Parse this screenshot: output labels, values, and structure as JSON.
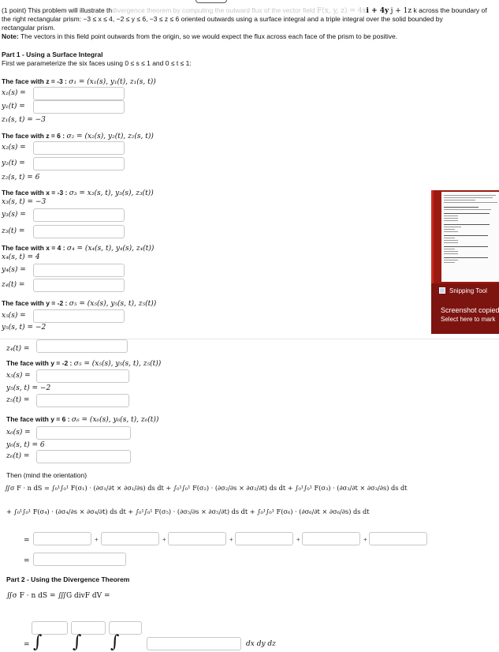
{
  "intro": {
    "line1_a": "(1 point) This problem will illustrate th",
    "line1_b": "divergence theorem by computing the outward flux of the vector field",
    "line1_c": "F(x, y, z) = 4x",
    "line1_d": "i + 4y",
    "line1_e": "j + 1z",
    "line1_f": "k across the boundary of",
    "line2": "the right rectangular prism: −3 ≤ x ≤ 4, −2 ≤ y ≤ 6, −3 ≤ z ≤ 6 oriented outwards using a surface integral and a triple integral over the solid bounded by",
    "line3": "rectangular prism.",
    "note_label": "Note:",
    "note_text": " The vectors in this field point outwards from the origin, so we would expect the flux across each face of the prism to be positive."
  },
  "part1": {
    "title": "Part 1 - Using a Surface Integral",
    "subtitle": "First we parameterize the six faces using 0 ≤ s ≤ 1 and 0 ≤ t ≤ 1:"
  },
  "faces": [
    {
      "title": "The face with z = -3 :",
      "math": "σ₁ = (x₁(s), y₁(t), z₁(s, t))",
      "l1": "x₁(s) =",
      "l2": "y₁(t) =",
      "l3": "z₁(s, t) = −3"
    },
    {
      "title": "The face with z = 6 :",
      "math": "σ₂ = (x₂(s), y₂(t), z₂(s, t))",
      "l1": "x₂(s) =",
      "l2": "y₂(t) =",
      "l3": "z₂(s, t) = 6"
    },
    {
      "title": "The face with x = -3 :",
      "math": "σ₃ = x₃(s, t), y₃(s), z₃(t))",
      "l1": "x₃(s, t) = −3",
      "l2": "y₃(s) =",
      "l3": "z₃(t) ="
    },
    {
      "title": "The face with x = 4 :",
      "math": "σ₄ = (x₄(s, t), y₄(s), z₄(t))",
      "l1": "x₄(s, t) = 4",
      "l2": "y₄(s) =",
      "l3": "z₄(t) ="
    },
    {
      "title": "The face with y = -2 :",
      "math": "σ₅ = (x₅(s), y₅(s, t), z₅(t))",
      "l1": "x₅(s) =",
      "l2": "y₅(s, t) = −2"
    }
  ],
  "second": {
    "z4": "z₄(t) =",
    "face5_title": "The face with y = -2 :",
    "face5_math": "σ₅ = (x₅(s), y₅(s, t), z₅(t))",
    "face5_l1": "x₅(s) =",
    "face5_l2": "y₅(s, t) = −2",
    "face5_l3": "z₅(t) =",
    "face6_title": "The face with y = 6 :",
    "face6_math": "σ₆ = (x₆(s), y₆(s, t), z₆(t))",
    "face6_l1": "x₆(s) =",
    "face6_l2": "y₆(s, t) = 6",
    "face6_l3": "z₆(t) =",
    "then": "Then (mind the orientation)",
    "eq1": "∬σ F · n dS = ∫₀¹∫₀¹ F(σ₁) · (∂σ₁/∂t × ∂σ₁/∂s) ds dt + ∫₀¹∫₀¹ F(σ₂) · (∂σ₂/∂s × ∂σ₂/∂t) ds dt + ∫₀¹∫₀¹ F(σ₃) · (∂σ₃/∂t × ∂σ₃/∂s) ds dt",
    "eq2": "+ ∫₀¹∫₀¹ F(σ₄) · (∂σ₄/∂s × ∂σ₄/∂t) ds dt + ∫₀¹∫₀¹ F(σ₅) · (∂σ₅/∂s × ∂σ₅/∂t) ds dt + ∫₀¹∫₀¹ F(σ₆) · (∂σ₆/∂t × ∂σ₆/∂s) ds dt",
    "eq_sign": "=",
    "plus": "+",
    "part2_title": "Part 2 - Using the Divergence Theorem",
    "part2_eq": "∬σ F · n dS = ∭G divF dV =",
    "last_eq": "=",
    "last_diff": "dx dy dz"
  },
  "snipping": {
    "app": "Snipping Tool",
    "title": "Screenshot copied",
    "sub": "Select here to mark"
  },
  "colors": {
    "snip_bg": "#7d1410",
    "box_border": "#c8c8c8"
  }
}
